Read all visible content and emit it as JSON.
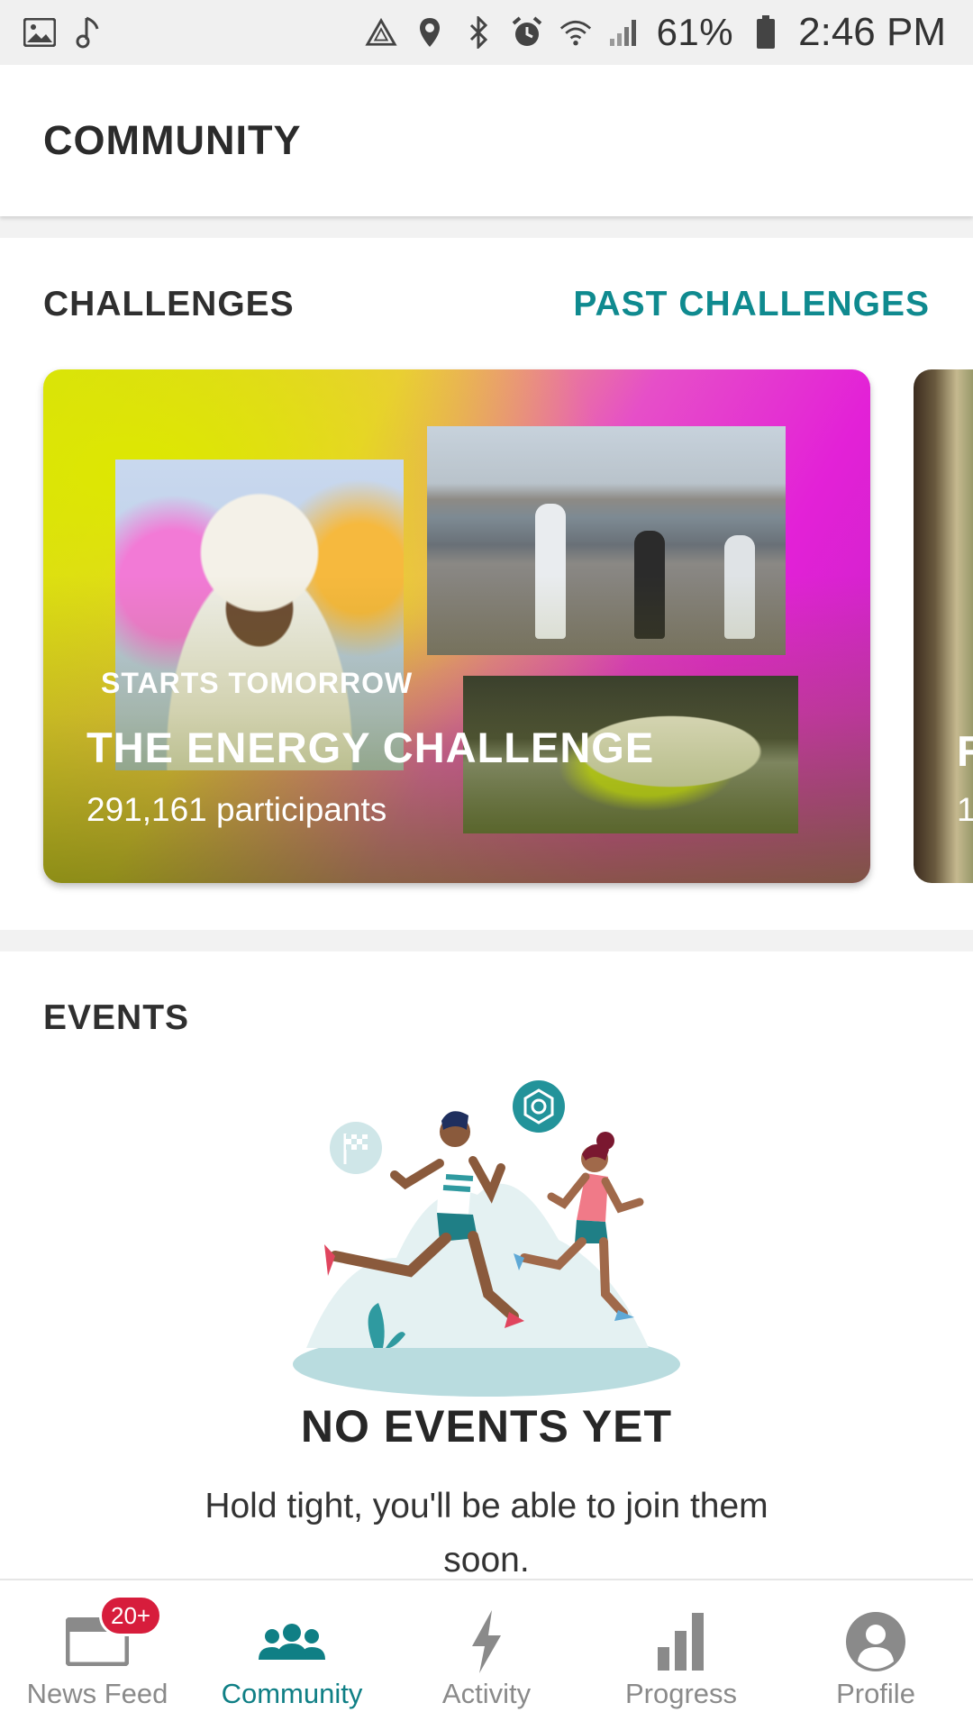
{
  "status_bar": {
    "battery_percent": "61%",
    "time": "2:46 PM",
    "icons_left": [
      "image-icon",
      "music-note-icon"
    ],
    "icons_right": [
      "recycle-icon",
      "location-icon",
      "bluetooth-icon",
      "alarm-icon",
      "wifi-icon",
      "signal-icon",
      "battery-icon"
    ]
  },
  "header": {
    "title": "COMMUNITY"
  },
  "challenges": {
    "title": "CHALLENGES",
    "past_link": "PAST CHALLENGES",
    "cards": [
      {
        "status": "STARTS TOMORROW",
        "name": "THE ENERGY CHALLENGE",
        "participants": "291,161 participants"
      },
      {
        "name_fragment": "R",
        "participants_fragment": "1"
      }
    ]
  },
  "events": {
    "title": "EVENTS",
    "empty_title": "NO EVENTS YET",
    "empty_body": "Hold tight, you'll be able to join them soon."
  },
  "bottom_nav": {
    "items": [
      {
        "label": "News Feed",
        "icon": "news-feed-icon",
        "badge": "20+",
        "active": false
      },
      {
        "label": "Community",
        "icon": "community-icon",
        "active": true
      },
      {
        "label": "Activity",
        "icon": "bolt-icon",
        "active": false
      },
      {
        "label": "Progress",
        "icon": "bar-chart-icon",
        "active": false
      },
      {
        "label": "Profile",
        "icon": "profile-icon",
        "active": false
      }
    ]
  },
  "colors": {
    "accent_teal": "#0f8a8f",
    "badge_red": "#d71d3c",
    "text_dark": "#2b2b2b",
    "nav_inactive": "#8a8a8a"
  }
}
